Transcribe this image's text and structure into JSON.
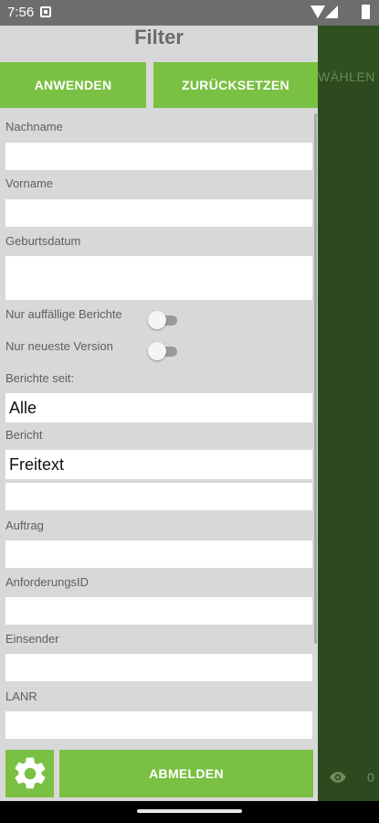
{
  "status_bar": {
    "time": "7:56"
  },
  "background_app": {
    "header_partial_title": "WÄHLEN",
    "view_count": "0"
  },
  "drawer": {
    "title": "Filter",
    "apply_label": "ANWENDEN",
    "reset_label": "ZURÜCKSETZEN",
    "fields": {
      "lastname_label": "Nachname",
      "lastname_value": "",
      "firstname_label": "Vorname",
      "firstname_value": "",
      "birthdate_label": "Geburtsdatum",
      "birthdate_value": "",
      "abnormal_label": "Nur auffällige Berichte",
      "abnormal_on": false,
      "latest_label": "Nur neueste Version",
      "latest_on": false,
      "since_label": "Berichte seit:",
      "since_value": "Alle",
      "report_label": "Bericht",
      "report_value": "Freitext",
      "report_extra_value": "",
      "order_label": "Auftrag",
      "order_value": "",
      "request_id_label": "AnforderungsID",
      "request_id_value": "",
      "sender_label": "Einsender",
      "sender_value": "",
      "lanr_label": "LANR",
      "lanr_value": ""
    },
    "logout_label": "ABMELDEN"
  },
  "colors": {
    "accent": "#7ac043",
    "background_app": "#2d4a1f",
    "drawer": "#d8d8d8"
  }
}
